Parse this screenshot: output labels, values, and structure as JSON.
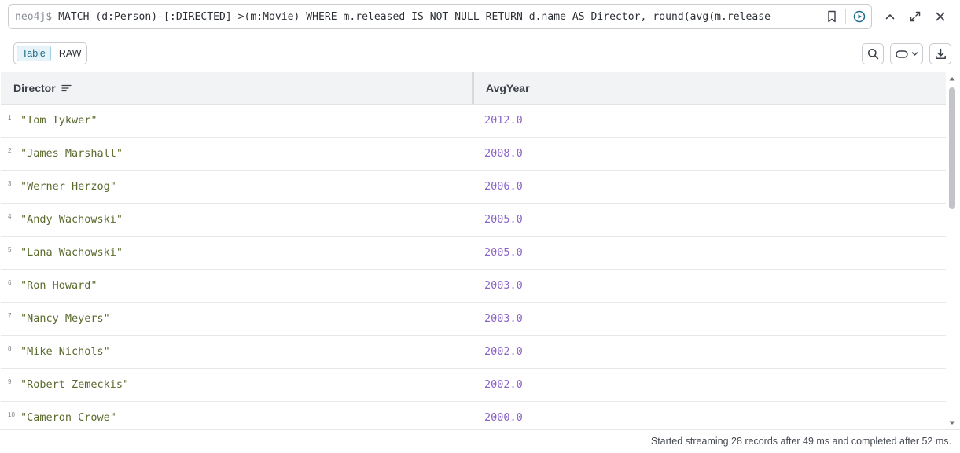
{
  "query": {
    "prompt": "neo4j$",
    "text": "MATCH (d:Person)-[:DIRECTED]->(m:Movie) WHERE m.released IS NOT NULL RETURN d.name AS Director, round(avg(m.release"
  },
  "icons": {
    "favorite": "bookmark-icon",
    "run": "play-circle-icon",
    "collapse": "chevron-up-icon",
    "fullscreen": "expand-icon",
    "close": "close-icon",
    "search": "search-icon",
    "highlight": "pill-toggle-icon",
    "download": "download-icon",
    "sort": "sort-lines-icon"
  },
  "toolbar": {
    "table_label": "Table",
    "raw_label": "RAW"
  },
  "table": {
    "columns": [
      "Director",
      "AvgYear"
    ],
    "rows": [
      {
        "n": "1",
        "director": "\"Tom Tykwer\"",
        "avg": "2012.0"
      },
      {
        "n": "2",
        "director": "\"James Marshall\"",
        "avg": "2008.0"
      },
      {
        "n": "3",
        "director": "\"Werner Herzog\"",
        "avg": "2006.0"
      },
      {
        "n": "4",
        "director": "\"Andy Wachowski\"",
        "avg": "2005.0"
      },
      {
        "n": "5",
        "director": "\"Lana Wachowski\"",
        "avg": "2005.0"
      },
      {
        "n": "6",
        "director": "\"Ron Howard\"",
        "avg": "2003.0"
      },
      {
        "n": "7",
        "director": "\"Nancy Meyers\"",
        "avg": "2003.0"
      },
      {
        "n": "8",
        "director": "\"Mike Nichols\"",
        "avg": "2002.0"
      },
      {
        "n": "9",
        "director": "\"Robert Zemeckis\"",
        "avg": "2002.0"
      },
      {
        "n": "10",
        "director": "\"Cameron Crowe\"",
        "avg": "2000.0"
      }
    ]
  },
  "status": {
    "text": "Started streaming 28 records after 49 ms and completed after 52 ms."
  },
  "colors": {
    "string_value": "#5b6b2e",
    "number_value": "#8a63c9",
    "run_accent": "#1d6b8a"
  }
}
